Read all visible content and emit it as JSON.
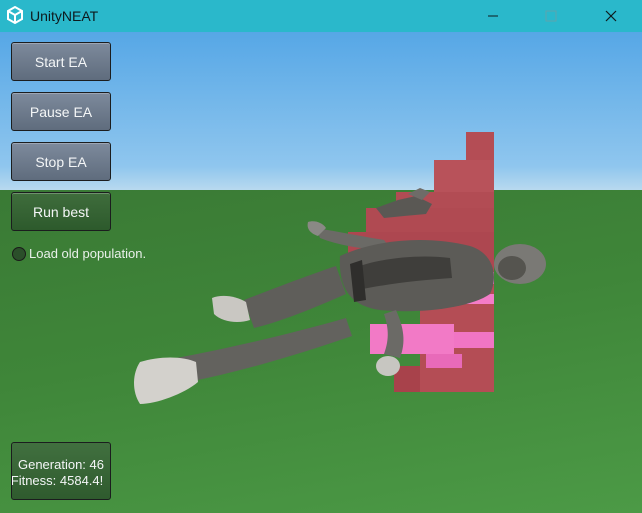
{
  "window": {
    "title": "UnityNEAT",
    "logo_icon": "unity-logo-icon",
    "controls": [
      "minimize-icon",
      "maximize-icon",
      "close-icon"
    ]
  },
  "panel": {
    "buttons": {
      "start": "Start EA",
      "pause": "Pause EA",
      "stop": "Stop EA",
      "run_best": "Run best"
    },
    "load_old_population": {
      "label": "Load old population.",
      "checked": false
    }
  },
  "stats": {
    "generation": "Generation: 46",
    "fitness": "Fitness: 4584.4!"
  },
  "colors": {
    "titlebar": "#2ab8cb",
    "button_light": "#6d7a8b",
    "button_dark": "#355f33",
    "obstacle": "#b44d55",
    "obstacle_highlight": "#f175c4",
    "ground": "#3f8639",
    "sky": "#76b6ea"
  }
}
